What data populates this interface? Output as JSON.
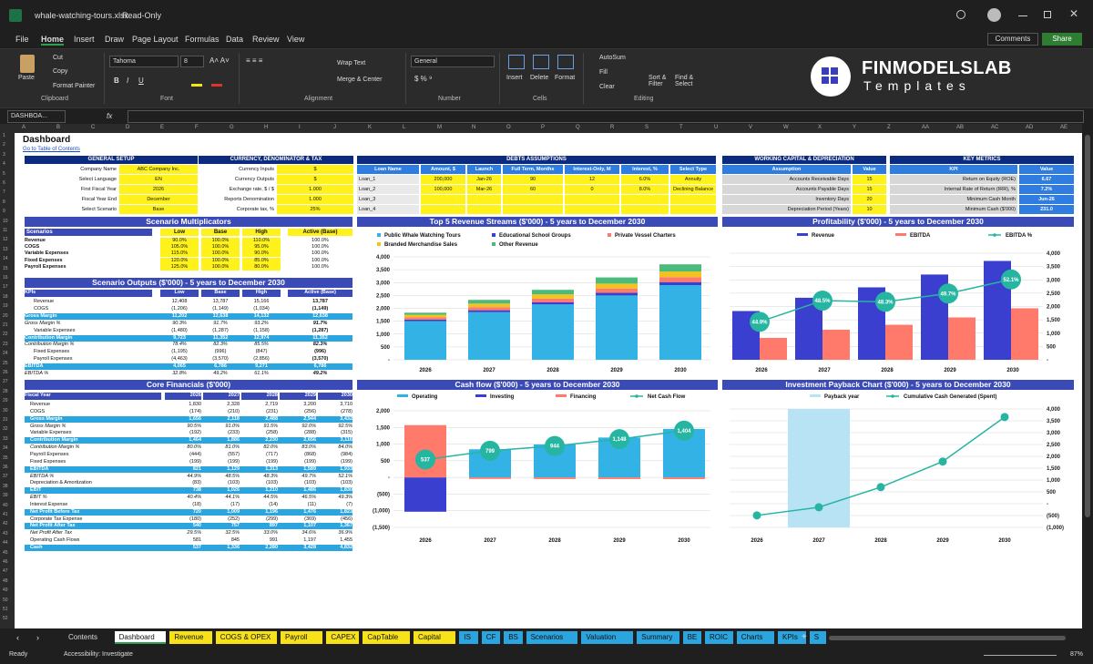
{
  "window": {
    "title": "whale-watching-tours.xlsx",
    "mode": "Read-Only",
    "comments": "Comments",
    "share": "Share"
  },
  "menu": [
    "File",
    "Home",
    "Insert",
    "Draw",
    "Page Layout",
    "Formulas",
    "Data",
    "Review",
    "View"
  ],
  "ribbon": {
    "clipboard": {
      "paste": "Paste",
      "cut": "Cut",
      "copy": "Copy",
      "format_painter": "Format Painter",
      "group": "Clipboard"
    },
    "font": {
      "name": "Tahoma",
      "size": "8",
      "group": "Font"
    },
    "alignment": {
      "wrap": "Wrap Text",
      "merge": "Merge & Center",
      "group": "Alignment"
    },
    "number": {
      "format": "General",
      "group": "Number"
    },
    "cells": {
      "insert": "Insert",
      "delete": "Delete",
      "format": "Format",
      "group": "Cells"
    },
    "editing": {
      "autosum": "AutoSum",
      "fill": "Fill",
      "clear": "Clear",
      "sort": "Sort & Filter",
      "find": "Find & Select",
      "group": "Editing"
    }
  },
  "logo": {
    "name": "FINMODELSLAB",
    "tag": "Templates"
  },
  "formula_bar": {
    "name_box": "DASHBOA...",
    "fx": "fx"
  },
  "columns": [
    "A",
    "B",
    "C",
    "D",
    "E",
    "F",
    "G",
    "H",
    "I",
    "J",
    "K",
    "L",
    "M",
    "N",
    "O",
    "P",
    "Q",
    "R",
    "S",
    "T",
    "U",
    "V",
    "W",
    "X",
    "Y",
    "Z",
    "AA",
    "AB",
    "AC",
    "AD",
    "AE"
  ],
  "sheet": {
    "title": "Dashboard",
    "link": "Go to Table of Contents"
  },
  "general_setup": {
    "header": "GENERAL SETUP",
    "rows": [
      [
        "Company Name",
        "ABC Company Inc."
      ],
      [
        "Select Language",
        "EN"
      ],
      [
        "First Fiscal Year",
        "2026"
      ],
      [
        "Fiscal Year End",
        "December"
      ],
      [
        "Select Scenario",
        "Base"
      ]
    ]
  },
  "currency": {
    "header": "CURRENCY, DENOMINATOR & TAX",
    "rows": [
      [
        "Currency Inputs",
        "$"
      ],
      [
        "Currency Outputs",
        "$"
      ],
      [
        "Exchange rate, $ / $",
        "1.000"
      ],
      [
        "Reports Denomination",
        "1.000"
      ],
      [
        "Corporate tax, %",
        "25%"
      ]
    ]
  },
  "debts": {
    "header": "DEBTS ASSUMPTIONS",
    "cols": [
      "Loan Name",
      "Amount, $",
      "Launch",
      "Full Term, Months",
      "Interest-Only, M",
      "Interest, %",
      "Select Type"
    ],
    "rows": [
      [
        "Loan_1",
        "200,000",
        "Jan-26",
        "90",
        "12",
        "6.0%",
        "Annuity"
      ],
      [
        "Loan_2",
        "100,000",
        "Mar-26",
        "60",
        "0",
        "8.0%",
        "Declining Balance"
      ],
      [
        "Loan_3",
        "",
        "",
        "",
        "",
        "",
        ""
      ],
      [
        "Loan_4",
        "",
        "",
        "",
        "",
        "",
        ""
      ]
    ]
  },
  "working_capital": {
    "header": "WORKING CAPITAL & DEPRECIATION",
    "cols": [
      "Assumption",
      "Value"
    ],
    "rows": [
      [
        "Accounts Receivable Days",
        "15"
      ],
      [
        "Accounts Payable Days",
        "15"
      ],
      [
        "Inventory Days",
        "20"
      ],
      [
        "Depreciation Period (Years)",
        "10"
      ]
    ]
  },
  "key_metrics": {
    "header": "KEY METRICS",
    "cols": [
      "KPI",
      "Value"
    ],
    "rows": [
      [
        "Return on Equity (ROE)",
        "6.67"
      ],
      [
        "Internal Rate of Return (IRR), %",
        "7.2%"
      ],
      [
        "Minimum Cash Month",
        "Jun-26"
      ],
      [
        "Minimum Cash ($'000)",
        "231.0"
      ]
    ]
  },
  "scenario_mult": {
    "header": "Scenario Multiplicators",
    "cols": [
      "Scenarios",
      "Low",
      "Base",
      "High",
      "Active (Base)"
    ],
    "rows": [
      [
        "Revenue",
        "90.0%",
        "100.0%",
        "110.0%",
        "100.0%"
      ],
      [
        "COGS",
        "105.0%",
        "100.0%",
        "95.0%",
        "100.0%"
      ],
      [
        "Variable Expenses",
        "115.0%",
        "100.0%",
        "90.0%",
        "100.0%"
      ],
      [
        "Fixed Expenses",
        "120.0%",
        "100.0%",
        "85.0%",
        "100.0%"
      ],
      [
        "Payroll Expenses",
        "125.0%",
        "100.0%",
        "80.0%",
        "100.0%"
      ]
    ]
  },
  "scenario_out": {
    "header": "Scenario Outputs ($'000) - 5 years to December 2030",
    "cols": [
      "KPIs",
      "Low",
      "Base",
      "High",
      "Active (Base)"
    ],
    "rows": [
      [
        "Revenue",
        "12,408",
        "13,787",
        "15,166",
        "13,787",
        0
      ],
      [
        "COGS",
        "(1,206)",
        "(1,149)",
        "(1,034)",
        "(1,149)",
        0
      ],
      [
        "Gross Margin",
        "11,202",
        "12,638",
        "14,132",
        "12,638",
        1
      ],
      [
        "Gross Margin %",
        "90.3%",
        "91.7%",
        "93.2%",
        "91.7%",
        2
      ],
      [
        "Variable Expenses",
        "(1,480)",
        "(1,287)",
        "(1,158)",
        "(1,287)",
        0
      ],
      [
        "Contribution Margin",
        "9,723",
        "11,352",
        "12,974",
        "11,352",
        1
      ],
      [
        "Contribution Margin %",
        "78.4%",
        "82.3%",
        "85.5%",
        "82.3%",
        2
      ],
      [
        "Fixed Expenses",
        "(1,195)",
        "(996)",
        "(847)",
        "(996)",
        0
      ],
      [
        "Payroll Expenses",
        "(4,463)",
        "(3,570)",
        "(2,856)",
        "(3,570)",
        0
      ],
      [
        "EBITDA",
        "4,065",
        "6,786",
        "9,271",
        "6,786",
        1
      ],
      [
        "EBITDA %",
        "32.8%",
        "49.2%",
        "61.1%",
        "49.2%",
        2
      ]
    ]
  },
  "core": {
    "header": "Core Financials ($'000)",
    "cols": [
      "Fiscal Year",
      "2026",
      "2027",
      "2028",
      "2029",
      "2030"
    ],
    "rows": [
      [
        "Revenue",
        "1,830",
        "2,328",
        "2,719",
        "3,200",
        "3,710",
        0
      ],
      [
        "COGS",
        "(174)",
        "(210)",
        "(231)",
        "(256)",
        "(278)",
        0
      ],
      [
        "Gross Margin",
        "1,656",
        "2,118",
        "2,488",
        "2,944",
        "3,432",
        1
      ],
      [
        "Gross Margin %",
        "90.5%",
        "91.0%",
        "91.5%",
        "92.0%",
        "92.5%",
        2
      ],
      [
        "Variable Expenses",
        "(192)",
        "(233)",
        "(258)",
        "(288)",
        "(315)",
        0
      ],
      [
        "Contribution Margin",
        "1,464",
        "1,886",
        "2,230",
        "2,656",
        "3,116",
        1
      ],
      [
        "Contribution Margin %",
        "80.0%",
        "81.0%",
        "82.0%",
        "83.0%",
        "84.0%",
        2
      ],
      [
        "Payroll Expenses",
        "(444)",
        "(557)",
        "(717)",
        "(868)",
        "(984)",
        0
      ],
      [
        "Fixed Expenses",
        "(199)",
        "(199)",
        "(199)",
        "(199)",
        "(199)",
        0
      ],
      [
        "EBITDA",
        "821",
        "1,129",
        "1,313",
        "1,589",
        "1,933",
        1
      ],
      [
        "EBITDA %",
        "44.9%",
        "48.5%",
        "48.3%",
        "49.7%",
        "52.1%",
        2
      ],
      [
        "Depreciation & Amortization",
        "(83)",
        "(103)",
        "(103)",
        "(103)",
        "(103)",
        0
      ],
      [
        "EBIT",
        "738",
        "1,026",
        "1,210",
        "1,486",
        "1,830",
        1
      ],
      [
        "EBIT %",
        "40.4%",
        "44.1%",
        "44.5%",
        "46.5%",
        "49.3%",
        2
      ],
      [
        "Interest Expense",
        "(18)",
        "(17)",
        "(14)",
        "(11)",
        "(7)",
        0
      ],
      [
        "Net Profit Before Tax",
        "720",
        "1,009",
        "1,196",
        "1,476",
        "1,823",
        1
      ],
      [
        "Corporate Tax Expense",
        "(180)",
        "(252)",
        "(299)",
        "(369)",
        "(456)",
        0
      ],
      [
        "Net Profit After Tax",
        "540",
        "757",
        "897",
        "1,107",
        "1,367",
        1
      ],
      [
        "Net Profit After Tax",
        "29.5%",
        "32.5%",
        "33.0%",
        "34.6%",
        "36.9%",
        2
      ],
      [
        "Operating Cash Flows",
        "581",
        "845",
        "991",
        "1,197",
        "1,455",
        0
      ],
      [
        "Cash",
        "537",
        "1,336",
        "2,280",
        "3,428",
        "4,832",
        1
      ]
    ]
  },
  "chart_data": [
    {
      "type": "bar",
      "title": "Top 5 Revenue Streams ($'000) - 5 years to December 2030",
      "categories": [
        "2026",
        "2027",
        "2028",
        "2029",
        "2030"
      ],
      "ylim": [
        0,
        4000
      ],
      "colors": [
        "#33b3e5",
        "#3b3fcf",
        "#ff7a6b",
        "#f3c21e",
        "#4cba7c"
      ],
      "series": [
        {
          "name": "Public Whale Watching Tours",
          "values": [
            1500,
            1850,
            2150,
            2500,
            2900
          ]
        },
        {
          "name": "Educational School Groups",
          "values": [
            60,
            75,
            90,
            105,
            120
          ]
        },
        {
          "name": "Private Vessel Charters",
          "values": [
            90,
            120,
            140,
            165,
            190
          ]
        },
        {
          "name": "Branded Merchandise Sales",
          "values": [
            100,
            140,
            165,
            190,
            220
          ]
        },
        {
          "name": "Other Revenue",
          "values": [
            80,
            143,
            174,
            240,
            280
          ]
        }
      ]
    },
    {
      "type": "bar",
      "title": "Profitability ($'000) - 5 years to December 2030",
      "categories": [
        "2026",
        "2027",
        "2028",
        "2029",
        "2030"
      ],
      "ylim": [
        0,
        4000
      ],
      "series": [
        {
          "name": "Revenue",
          "values": [
            1830,
            2328,
            2719,
            3200,
            3710
          ],
          "color": "#3b3fcf"
        },
        {
          "name": "EBITDA",
          "values": [
            821,
            1129,
            1313,
            1589,
            1933
          ],
          "color": "#ff7a6b"
        },
        {
          "name": "EBITDA %",
          "values": [
            44.9,
            48.5,
            48.3,
            49.7,
            52.1
          ],
          "color": "#26b5a0",
          "labels": [
            "44.9%",
            "48.5%",
            "48.3%",
            "49.7%",
            "52.1%"
          ]
        }
      ]
    },
    {
      "type": "bar",
      "title": "Cash flow ($'000) - 5 years to December 2030",
      "categories": [
        "2026",
        "2027",
        "2028",
        "2029",
        "2030"
      ],
      "ylim": [
        -1500,
        2000
      ],
      "ticks": [
        "2,000",
        "1,500",
        "1,000",
        "500",
        "-",
        "(500)",
        "(1,000)",
        "(1,500)"
      ],
      "series": [
        {
          "name": "Operating",
          "values": [
            0,
            845,
            991,
            1197,
            1455
          ],
          "color": "#33b3e5"
        },
        {
          "name": "Investing",
          "values": [
            -1030,
            0,
            0,
            0,
            0
          ],
          "color": "#3b3fcf"
        },
        {
          "name": "Financing",
          "values": [
            1570,
            -46,
            -47,
            -49,
            -51
          ],
          "color": "#ff7a6b"
        },
        {
          "name": "Net Cash Flow",
          "values": [
            537,
            799,
            944,
            1148,
            1404
          ],
          "color": "#26b5a0",
          "labels": [
            "537",
            "799",
            "944",
            "1,148",
            "1,404"
          ]
        }
      ]
    },
    {
      "type": "line",
      "title": "Investment Payback Chart ($'000) - 5 years to December 2030",
      "categories": [
        "2026",
        "2027",
        "2028",
        "2029",
        "2030"
      ],
      "ylim": [
        -1000,
        4000
      ],
      "ticks": [
        "4,000",
        "3,500",
        "3,000",
        "2,500",
        "2,000",
        "1,500",
        "1,000",
        "500",
        "-",
        "(500)",
        "(1,000)"
      ],
      "series": [
        {
          "name": "Payback year",
          "values": [
            "2027"
          ],
          "color": "#b8e3f5"
        },
        {
          "name": "Cumulative Cash Generated (Spent)",
          "values": [
            -493,
            -150,
            700,
            1780,
            3660
          ],
          "color": "#26b5a0"
        }
      ]
    }
  ],
  "tabs": [
    {
      "l": "Contents",
      "c": "#1f1f1f",
      "t": "#ddd"
    },
    {
      "l": "Dashboard",
      "c": "#fff",
      "t": "#111"
    },
    {
      "l": "Revenue",
      "c": "#f7e21a",
      "t": "#111"
    },
    {
      "l": "COGS & OPEX",
      "c": "#f7e21a",
      "t": "#111"
    },
    {
      "l": "Payroll",
      "c": "#f7e21a",
      "t": "#111"
    },
    {
      "l": "CAPEX",
      "c": "#f7e21a",
      "t": "#111"
    },
    {
      "l": "CapTable",
      "c": "#f7e21a",
      "t": "#111"
    },
    {
      "l": "Capital",
      "c": "#f7e21a",
      "t": "#111"
    },
    {
      "l": "IS",
      "c": "#2aa5df",
      "t": "#111"
    },
    {
      "l": "CF",
      "c": "#2aa5df",
      "t": "#111"
    },
    {
      "l": "BS",
      "c": "#2aa5df",
      "t": "#111"
    },
    {
      "l": "Scenarios",
      "c": "#2aa5df",
      "t": "#111"
    },
    {
      "l": "Valuation",
      "c": "#2aa5df",
      "t": "#111"
    },
    {
      "l": "Summary",
      "c": "#2aa5df",
      "t": "#111"
    },
    {
      "l": "BE",
      "c": "#2aa5df",
      "t": "#111"
    },
    {
      "l": "ROIC",
      "c": "#2aa5df",
      "t": "#111"
    },
    {
      "l": "Charts",
      "c": "#2aa5df",
      "t": "#111"
    },
    {
      "l": "KPIs",
      "c": "#2aa5df",
      "t": "#111"
    },
    {
      "l": "S",
      "c": "#2aa5df",
      "t": "#111"
    }
  ],
  "status": {
    "ready": "Ready",
    "accessibility": "Accessibility: Investigate",
    "zoom": "87%"
  }
}
